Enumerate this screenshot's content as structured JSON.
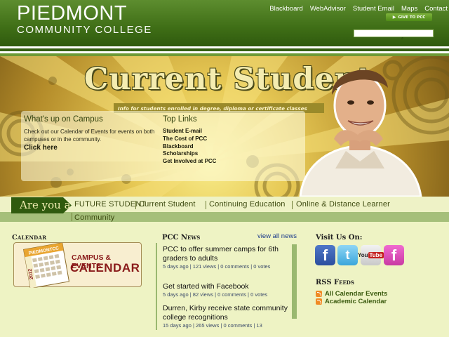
{
  "header": {
    "logo_line1": "PIEDMONT",
    "logo_line2": "COMMUNITY COLLEGE",
    "nav": [
      "Blackboard",
      "WebAdvisor",
      "Student Email",
      "Maps",
      "Contact"
    ],
    "give_label": "GIVE TO PCC",
    "search_placeholder": ""
  },
  "banner": {
    "title": "Current Student",
    "tagline": "Info for students enrolled in degree, diploma or certificate classes",
    "whats_up_heading": "What's up on Campus",
    "whats_up_text": "Check out our Calendar of Events for events on both campuses or in the community.",
    "click_here": "Click here",
    "top_links_heading": "Top Links",
    "top_links": [
      "Student E-mail",
      "The Cost of PCC",
      "Blackboard",
      "Scholarships",
      "Get Involved at PCC"
    ]
  },
  "audience": {
    "label": "Are you a",
    "links": [
      "Future Student",
      "Current Student",
      "Continuing Education",
      "Online & Distance Learner",
      "Community"
    ]
  },
  "calendar": {
    "heading": "Calendar",
    "card_title1": "CAMPUS & EVENTS",
    "card_title2": "CALENDAR",
    "card_brand": "PIEDMONTCC",
    "card_year": "2012"
  },
  "news": {
    "heading": "PCC News",
    "view_all": "view all news",
    "items": [
      {
        "title": "PCC to offer summer camps for 6th graders to adults",
        "meta": "5 days ago | 121 views | 0 comments | 0 votes"
      },
      {
        "title": "Get started with Facebook",
        "meta": "5 days ago | 82 views | 0 comments | 0 votes"
      },
      {
        "title": "Durren, Kirby receive state community college recognitions",
        "meta": "15 days ago | 265 views | 0 comments | 13"
      }
    ]
  },
  "social": {
    "heading": "Visit Us On:",
    "icons": [
      "facebook-icon",
      "twitter-icon",
      "youtube-icon",
      "pink-facebook-icon"
    ],
    "facebook_glyph": "f",
    "twitter_glyph": "t",
    "youtube_you": "You",
    "youtube_tube": "Tube"
  },
  "rss": {
    "heading": "RSS Feeds",
    "feeds": [
      "All Calendar Events",
      "Academic Calendar"
    ]
  },
  "colors": {
    "header_green": "#3f6e16",
    "accent_dark_green": "#2f5a0e",
    "content_bg": "#eef3c4",
    "link_blue": "#1a3a8a"
  }
}
